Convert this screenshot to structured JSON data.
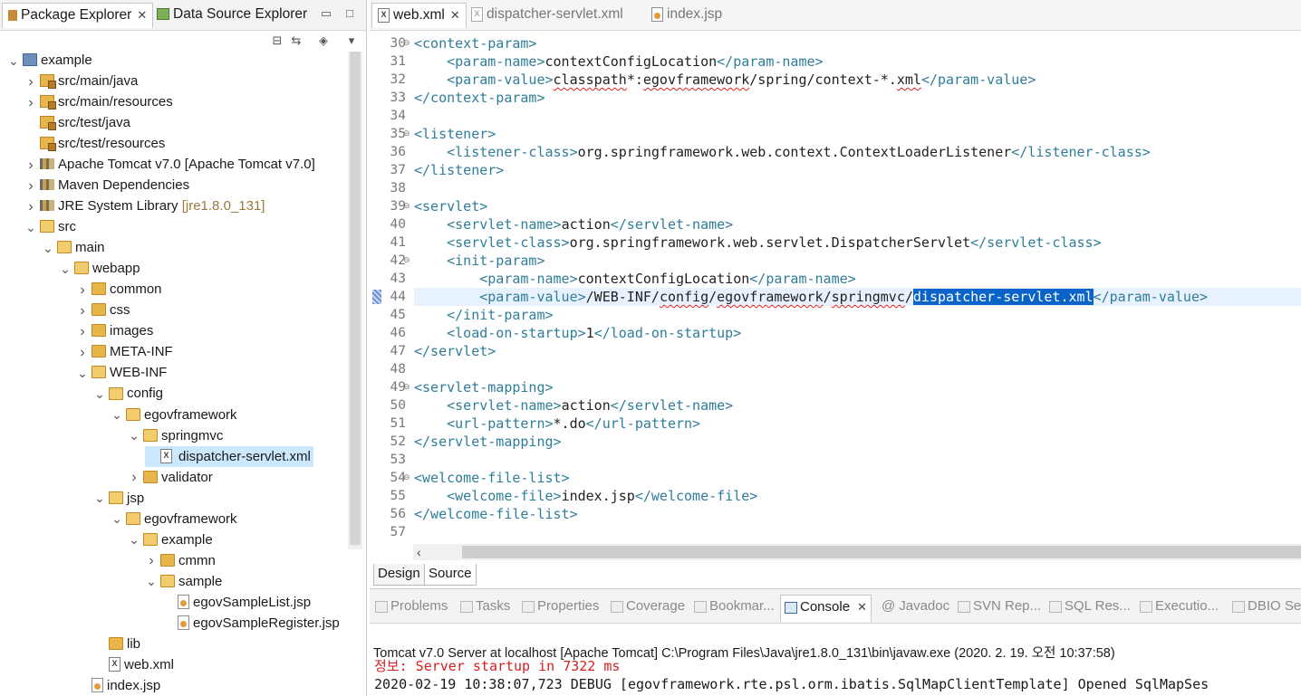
{
  "explorer": {
    "tabs": [
      {
        "label": "Package Explorer",
        "active": true
      },
      {
        "label": "Data Source Explorer",
        "active": false
      }
    ],
    "tree": [
      {
        "label": "example",
        "icon": "project-icon",
        "twisty": "open",
        "indent": 0
      },
      {
        "label": "src/main/java",
        "icon": "package-folder-icon",
        "twisty": "closed",
        "indent": 1
      },
      {
        "label": "src/main/resources",
        "icon": "package-folder-icon",
        "twisty": "closed",
        "indent": 1
      },
      {
        "label": "src/test/java",
        "icon": "package-folder-icon",
        "twisty": "none",
        "indent": 1
      },
      {
        "label": "src/test/resources",
        "icon": "package-folder-icon",
        "twisty": "none",
        "indent": 1
      },
      {
        "label": "Apache Tomcat v7.0 [Apache Tomcat v7.0]",
        "icon": "library-icon",
        "twisty": "closed",
        "indent": 1
      },
      {
        "label": "Maven Dependencies",
        "icon": "library-icon",
        "twisty": "closed",
        "indent": 1
      },
      {
        "label": "JRE System Library",
        "decoration": "[jre1.8.0_131]",
        "icon": "library-icon",
        "twisty": "closed",
        "indent": 1
      },
      {
        "label": "src",
        "icon": "folder-icon",
        "twisty": "open",
        "indent": 1
      },
      {
        "label": "main",
        "icon": "folder-icon",
        "twisty": "open",
        "indent": 2
      },
      {
        "label": "webapp",
        "icon": "folder-icon",
        "twisty": "open",
        "indent": 3
      },
      {
        "label": "common",
        "icon": "folder-icon",
        "twisty": "closed",
        "indent": 4
      },
      {
        "label": "css",
        "icon": "folder-icon",
        "twisty": "closed",
        "indent": 4
      },
      {
        "label": "images",
        "icon": "folder-icon",
        "twisty": "closed",
        "indent": 4
      },
      {
        "label": "META-INF",
        "icon": "folder-icon",
        "twisty": "closed",
        "indent": 4
      },
      {
        "label": "WEB-INF",
        "icon": "folder-icon",
        "twisty": "open",
        "indent": 4
      },
      {
        "label": "config",
        "icon": "folder-icon",
        "twisty": "open",
        "indent": 5
      },
      {
        "label": "egovframework",
        "icon": "folder-icon",
        "twisty": "open",
        "indent": 6
      },
      {
        "label": "springmvc",
        "icon": "folder-icon",
        "twisty": "open",
        "indent": 7
      },
      {
        "label": "dispatcher-servlet.xml",
        "icon": "xml-file-icon",
        "twisty": "none",
        "indent": 8,
        "selected": true
      },
      {
        "label": "validator",
        "icon": "folder-icon",
        "twisty": "closed",
        "indent": 7
      },
      {
        "label": "jsp",
        "icon": "folder-icon",
        "twisty": "open",
        "indent": 5
      },
      {
        "label": "egovframework",
        "icon": "folder-icon",
        "twisty": "open",
        "indent": 6
      },
      {
        "label": "example",
        "icon": "folder-icon",
        "twisty": "open",
        "indent": 7
      },
      {
        "label": "cmmn",
        "icon": "folder-icon",
        "twisty": "closed",
        "indent": 8
      },
      {
        "label": "sample",
        "icon": "folder-icon",
        "twisty": "open",
        "indent": 8
      },
      {
        "label": "egovSampleList.jsp",
        "icon": "jsp-file-icon",
        "twisty": "none",
        "indent": 9
      },
      {
        "label": "egovSampleRegister.jsp",
        "icon": "jsp-file-icon",
        "twisty": "none",
        "indent": 9
      },
      {
        "label": "lib",
        "icon": "folder-icon",
        "twisty": "none",
        "indent": 5
      },
      {
        "label": "web.xml",
        "icon": "xml-file-icon",
        "twisty": "none",
        "indent": 5
      },
      {
        "label": "index.jsp",
        "icon": "jsp-file-icon",
        "twisty": "none",
        "indent": 4
      }
    ]
  },
  "editor": {
    "tabs": [
      {
        "label": "web.xml",
        "active": true
      },
      {
        "label": "dispatcher-servlet.xml",
        "active": false
      },
      {
        "label": "index.jsp",
        "active": false
      }
    ],
    "lines": [
      {
        "n": "30",
        "fold": true,
        "segs": [
          [
            "t",
            "<context-param>"
          ]
        ]
      },
      {
        "n": "31",
        "segs": [
          [
            "s",
            "    "
          ],
          [
            "t",
            "<param-name>"
          ],
          [
            "x",
            "contextConfigLocation"
          ],
          [
            "t",
            "</param-name>"
          ]
        ]
      },
      {
        "n": "32",
        "segs": [
          [
            "s",
            "    "
          ],
          [
            "t",
            "<param-value>"
          ],
          [
            "w",
            "classpath"
          ],
          [
            "x",
            "*:"
          ],
          [
            "w",
            "egovframework"
          ],
          [
            "x",
            "/spring/context-*."
          ],
          [
            "w",
            "xml"
          ],
          [
            "t",
            "</param-value>"
          ]
        ]
      },
      {
        "n": "33",
        "segs": [
          [
            "t",
            "</context-param>"
          ]
        ]
      },
      {
        "n": "34",
        "segs": []
      },
      {
        "n": "35",
        "fold": true,
        "segs": [
          [
            "t",
            "<listener>"
          ]
        ]
      },
      {
        "n": "36",
        "segs": [
          [
            "s",
            "    "
          ],
          [
            "t",
            "<listener-class>"
          ],
          [
            "x",
            "org.springframework.web.context.ContextLoaderListener"
          ],
          [
            "t",
            "</listener-class>"
          ]
        ]
      },
      {
        "n": "37",
        "segs": [
          [
            "t",
            "</listener>"
          ]
        ]
      },
      {
        "n": "38",
        "segs": []
      },
      {
        "n": "39",
        "fold": true,
        "segs": [
          [
            "t",
            "<servlet>"
          ]
        ]
      },
      {
        "n": "40",
        "segs": [
          [
            "s",
            "    "
          ],
          [
            "t",
            "<servlet-name>"
          ],
          [
            "x",
            "action"
          ],
          [
            "t",
            "</servlet-name>"
          ]
        ]
      },
      {
        "n": "41",
        "segs": [
          [
            "s",
            "    "
          ],
          [
            "t",
            "<servlet-class>"
          ],
          [
            "x",
            "org.springframework.web.servlet.DispatcherServlet"
          ],
          [
            "t",
            "</servlet-class>"
          ]
        ]
      },
      {
        "n": "42",
        "fold": true,
        "segs": [
          [
            "s",
            "    "
          ],
          [
            "t",
            "<init-param>"
          ]
        ]
      },
      {
        "n": "43",
        "segs": [
          [
            "s",
            "        "
          ],
          [
            "t",
            "<param-name>"
          ],
          [
            "x",
            "contextConfigLocation"
          ],
          [
            "t",
            "</param-name>"
          ]
        ]
      },
      {
        "n": "44",
        "current": true,
        "segs": [
          [
            "s",
            "        "
          ],
          [
            "t",
            "<param-value>"
          ],
          [
            "x",
            "/WEB-INF/"
          ],
          [
            "w",
            "config"
          ],
          [
            "x",
            "/"
          ],
          [
            "w",
            "egovframework"
          ],
          [
            "x",
            "/"
          ],
          [
            "w",
            "springmvc"
          ],
          [
            "x",
            "/"
          ],
          [
            "h",
            "dispatcher-servlet.xml"
          ],
          [
            "t",
            "</param-value>"
          ]
        ]
      },
      {
        "n": "45",
        "segs": [
          [
            "s",
            "    "
          ],
          [
            "t",
            "</init-param>"
          ]
        ]
      },
      {
        "n": "46",
        "segs": [
          [
            "s",
            "    "
          ],
          [
            "t",
            "<load-on-startup>"
          ],
          [
            "x",
            "1"
          ],
          [
            "t",
            "</load-on-startup>"
          ]
        ]
      },
      {
        "n": "47",
        "segs": [
          [
            "t",
            "</servlet>"
          ]
        ]
      },
      {
        "n": "48",
        "segs": []
      },
      {
        "n": "49",
        "fold": true,
        "segs": [
          [
            "t",
            "<servlet-mapping>"
          ]
        ]
      },
      {
        "n": "50",
        "segs": [
          [
            "s",
            "    "
          ],
          [
            "t",
            "<servlet-name>"
          ],
          [
            "x",
            "action"
          ],
          [
            "t",
            "</servlet-name>"
          ]
        ]
      },
      {
        "n": "51",
        "segs": [
          [
            "s",
            "    "
          ],
          [
            "t",
            "<url-pattern>"
          ],
          [
            "x",
            "*.do"
          ],
          [
            "t",
            "</url-pattern>"
          ]
        ]
      },
      {
        "n": "52",
        "segs": [
          [
            "t",
            "</servlet-mapping>"
          ]
        ]
      },
      {
        "n": "53",
        "segs": []
      },
      {
        "n": "54",
        "fold": true,
        "segs": [
          [
            "t",
            "<welcome-file-list>"
          ]
        ]
      },
      {
        "n": "55",
        "segs": [
          [
            "s",
            "    "
          ],
          [
            "t",
            "<welcome-file>"
          ],
          [
            "x",
            "index.jsp"
          ],
          [
            "t",
            "</welcome-file>"
          ]
        ]
      },
      {
        "n": "56",
        "segs": [
          [
            "t",
            "</welcome-file-list>"
          ]
        ]
      },
      {
        "n": "57",
        "segs": []
      }
    ],
    "bottom_tabs": [
      {
        "label": "Design",
        "active": false
      },
      {
        "label": "Source",
        "active": true
      }
    ]
  },
  "console": {
    "tabs": [
      {
        "label": "Problems",
        "active": false
      },
      {
        "label": "Tasks",
        "active": false
      },
      {
        "label": "Properties",
        "active": false
      },
      {
        "label": "Coverage",
        "active": false
      },
      {
        "label": "Bookmar...",
        "active": false
      },
      {
        "label": "Console",
        "active": true
      },
      {
        "label": "Javadoc",
        "active": false
      },
      {
        "label": "SVN Rep...",
        "active": false
      },
      {
        "label": "SQL Res...",
        "active": false
      },
      {
        "label": "Executio...",
        "active": false
      },
      {
        "label": "DBIO Se...",
        "active": false
      }
    ],
    "title": "Tomcat v7.0 Server at localhost [Apache Tomcat] C:\\Program Files\\Java\\jre1.8.0_131\\bin\\javaw.exe (2020. 2. 19. 오전 10:37:58)",
    "lines": [
      {
        "text": "정보: Server startup in 7322 ms",
        "color": "#d62020"
      },
      {
        "text": "2020-02-19 10:38:07,723 DEBUG [egovframework.rte.psl.orm.ibatis.SqlMapClientTemplate] Opened SqlMapSes",
        "color": "#1a1a1a"
      }
    ]
  },
  "colors": {
    "tag": "#2e7d9a",
    "selection": "#0a64c8",
    "current_line": "#e8f2fe",
    "tree_selection": "#cce8ff",
    "error_text": "#d62020"
  }
}
